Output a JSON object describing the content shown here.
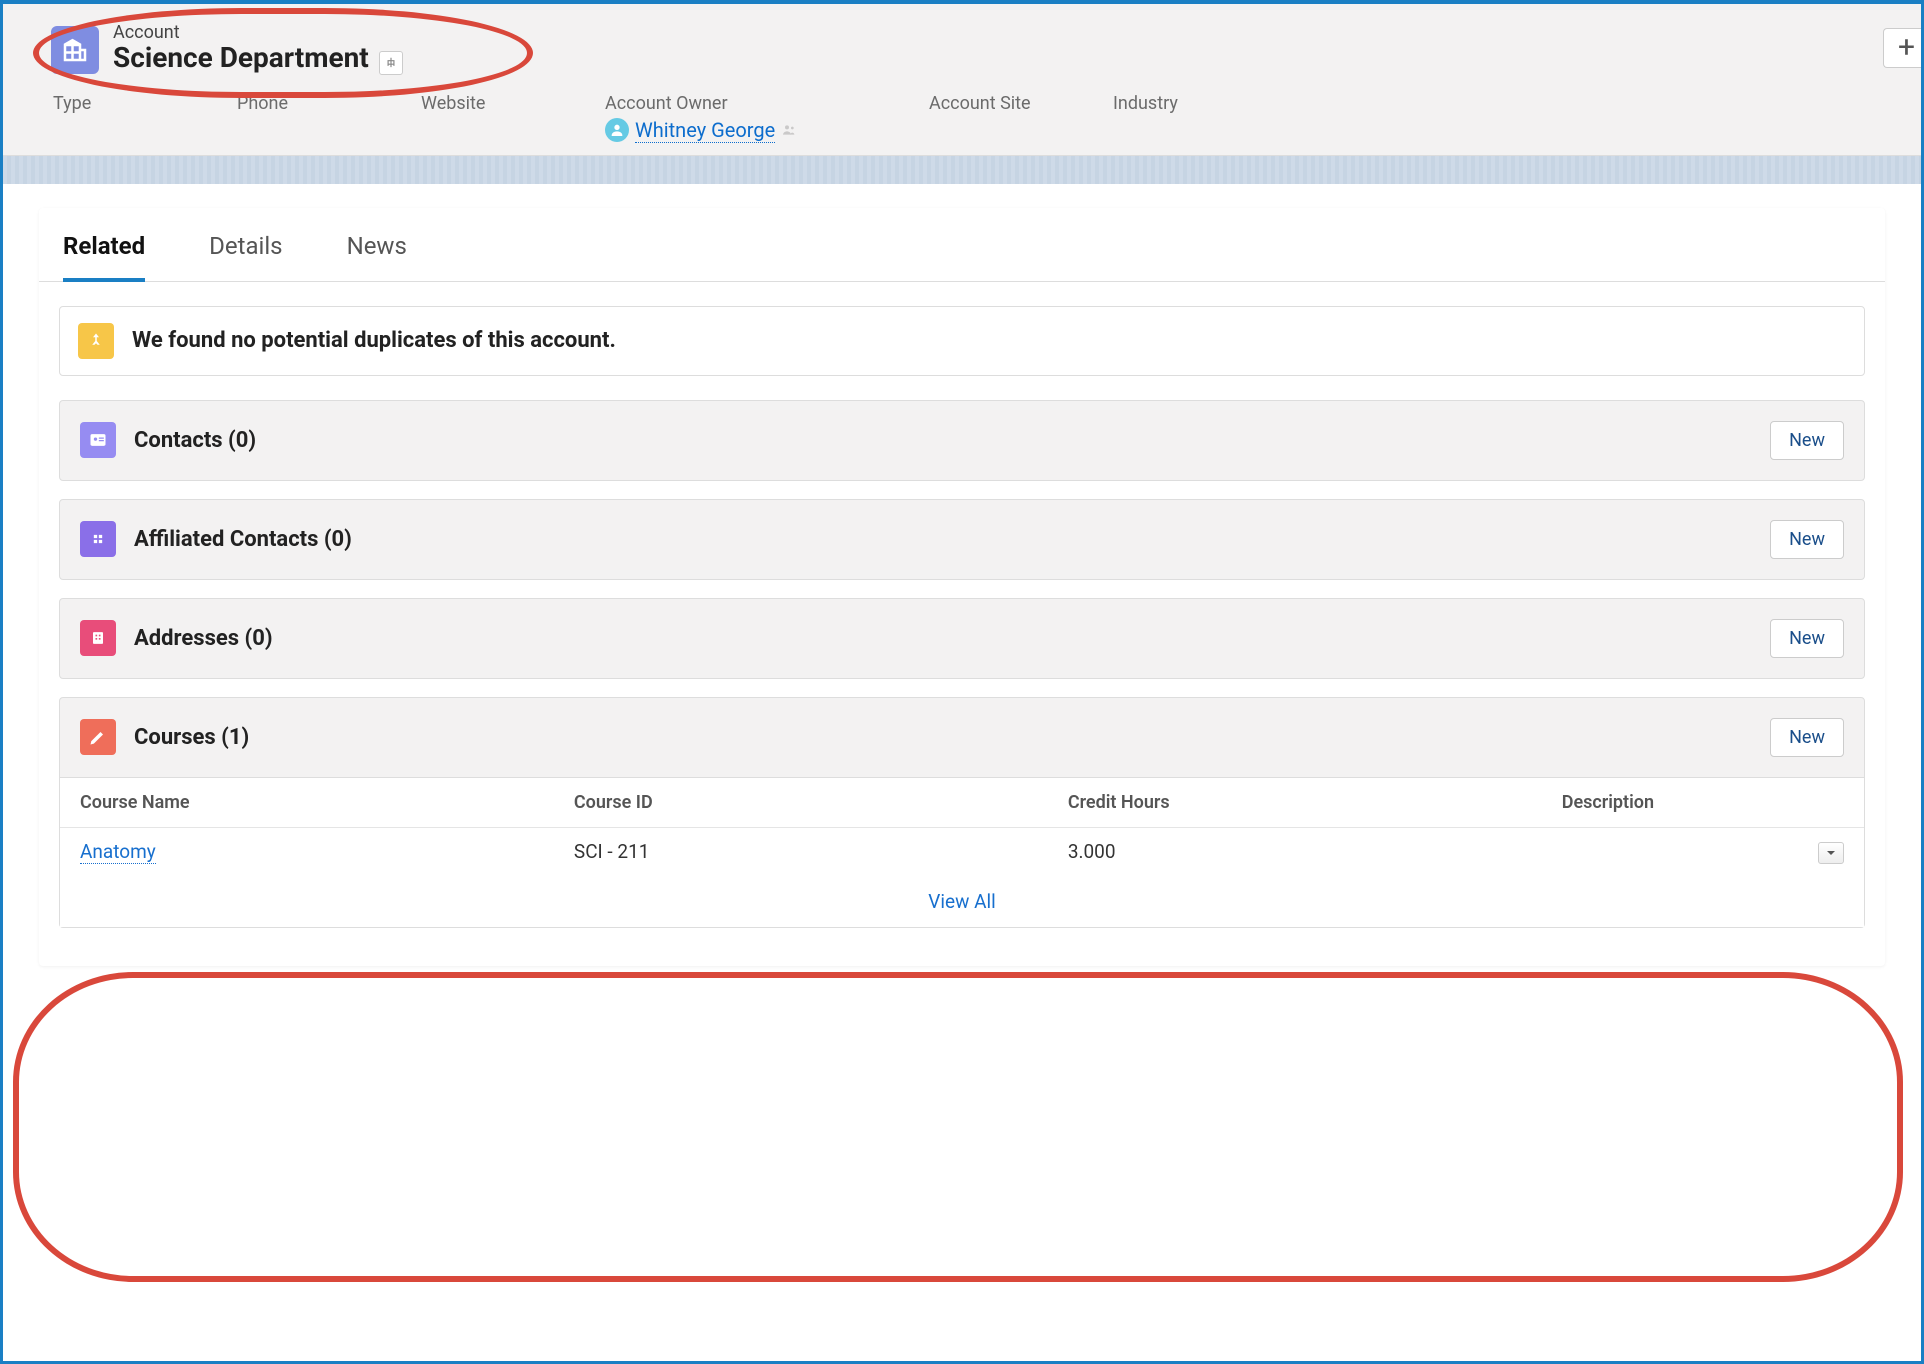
{
  "header": {
    "entity_type": "Account",
    "entity_name": "Science Department",
    "fields": [
      {
        "label": "Type"
      },
      {
        "label": "Phone"
      },
      {
        "label": "Website"
      },
      {
        "label": "Account Owner",
        "owner": "Whitney George"
      },
      {
        "label": "Account Site"
      },
      {
        "label": "Industry"
      }
    ],
    "plus": "+"
  },
  "tabs": {
    "items": [
      {
        "label": "Related",
        "active": true
      },
      {
        "label": "Details",
        "active": false
      },
      {
        "label": "News",
        "active": false
      }
    ]
  },
  "alert": {
    "text": "We found no potential duplicates of this account."
  },
  "related": {
    "contacts": {
      "title": "Contacts (0)",
      "new": "New",
      "icon_bg": "#968cf2"
    },
    "affiliated": {
      "title": "Affiliated Contacts (0)",
      "new": "New",
      "icon_bg": "#8a6fe8"
    },
    "addresses": {
      "title": "Addresses (0)",
      "new": "New",
      "icon_bg": "#e84d7a"
    },
    "courses": {
      "title": "Courses (1)",
      "new": "New",
      "icon_bg": "#ef6e5a",
      "columns": {
        "name": "Course Name",
        "id": "Course ID",
        "credit": "Credit Hours",
        "desc": "Description"
      },
      "rows": [
        {
          "name": "Anatomy",
          "id": "SCI - 211",
          "credit": "3.000",
          "desc": ""
        }
      ],
      "view_all": "View All"
    }
  }
}
